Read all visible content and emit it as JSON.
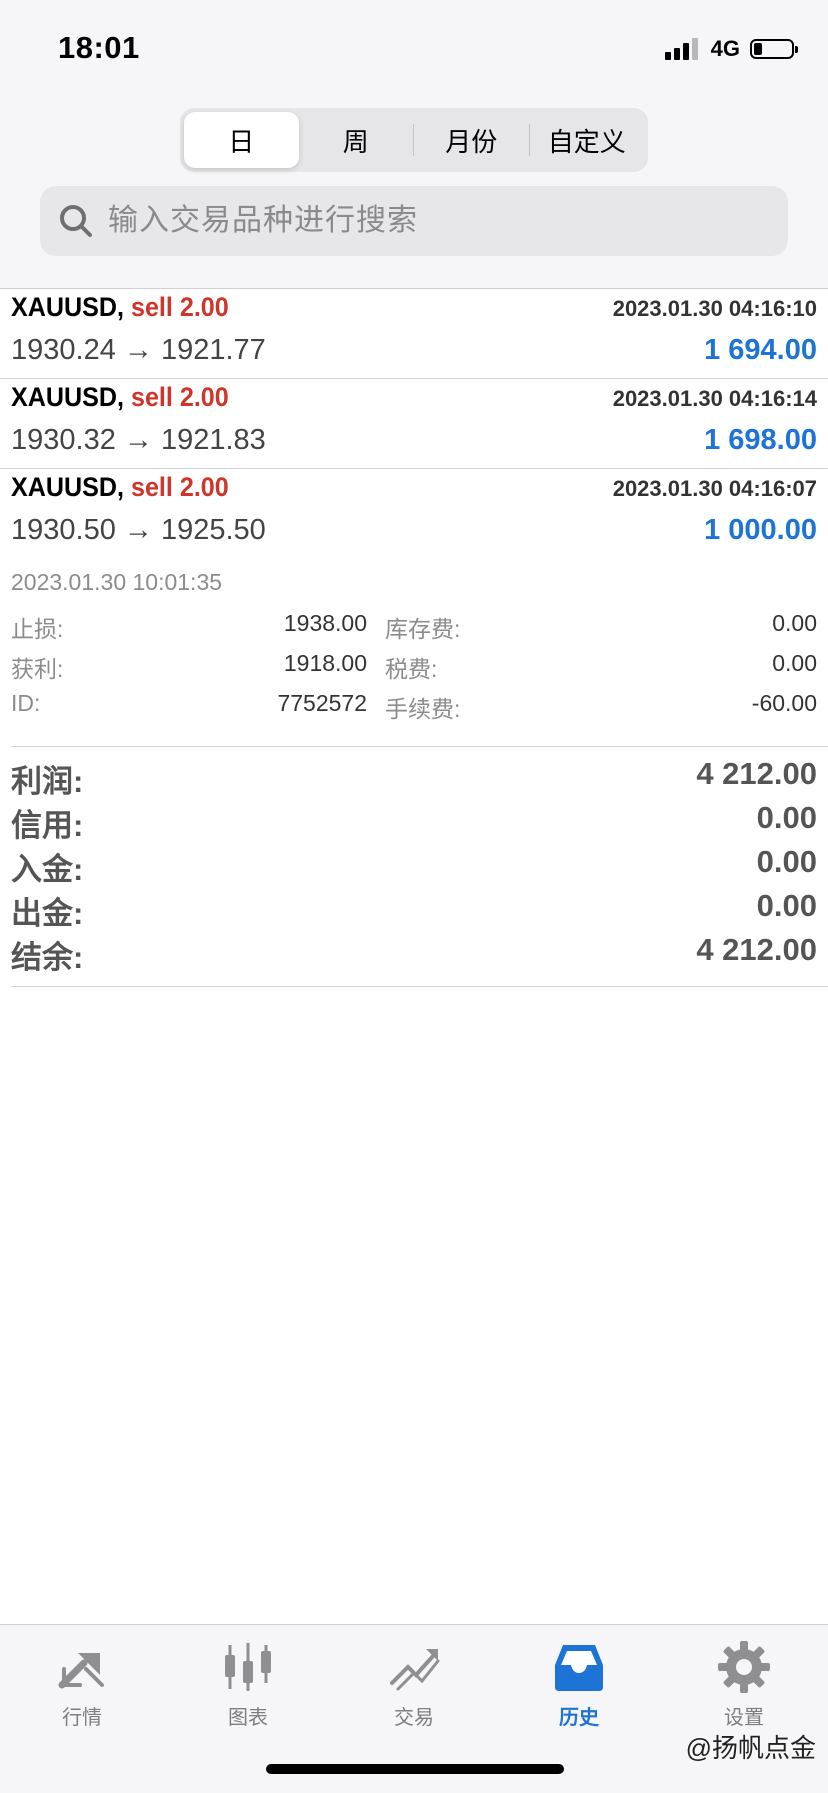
{
  "status_bar": {
    "time": "18:01",
    "network": "4G"
  },
  "period_tabs": [
    {
      "label": "日",
      "active": true
    },
    {
      "label": "周",
      "active": false
    },
    {
      "label": "月份",
      "active": false
    },
    {
      "label": "自定义",
      "active": false
    }
  ],
  "search": {
    "placeholder": "输入交易品种进行搜索",
    "value": ""
  },
  "trades": [
    {
      "symbol": "XAUUSD,",
      "side": "sell 2.00",
      "time": "2023.01.30 04:16:10",
      "prices": "1930.24 → 1921.77",
      "profit": "1 694.00"
    },
    {
      "symbol": "XAUUSD,",
      "side": "sell 2.00",
      "time": "2023.01.30 04:16:14",
      "prices": "1930.32 → 1921.83",
      "profit": "1 698.00"
    },
    {
      "symbol": "XAUUSD,",
      "side": "sell 2.00",
      "time": "2023.01.30 04:16:07",
      "prices": "1930.50 → 1925.50",
      "profit": "1 000.00"
    }
  ],
  "trade_detail": {
    "close_time": "2023.01.30 10:01:35",
    "rows": [
      {
        "label1": "止损:",
        "value1": "1938.00",
        "label2": "库存费:",
        "value2": "0.00"
      },
      {
        "label1": "获利:",
        "value1": "1918.00",
        "label2": "税费:",
        "value2": "0.00"
      },
      {
        "label1": "ID:",
        "value1": "7752572",
        "label2": "手续费:",
        "value2": "-60.00"
      }
    ]
  },
  "summary": [
    {
      "label": "利润:",
      "value": "4 212.00"
    },
    {
      "label": "信用:",
      "value": "0.00"
    },
    {
      "label": "入金:",
      "value": "0.00"
    },
    {
      "label": "出金:",
      "value": "0.00"
    },
    {
      "label": "结余:",
      "value": "4 212.00"
    }
  ],
  "tab_bar": [
    {
      "label": "行情",
      "icon": "quotes-icon",
      "active": false
    },
    {
      "label": "图表",
      "icon": "chart-icon",
      "active": false
    },
    {
      "label": "交易",
      "icon": "trade-icon",
      "active": false
    },
    {
      "label": "历史",
      "icon": "history-icon",
      "active": true
    },
    {
      "label": "设置",
      "icon": "settings-icon",
      "active": false
    }
  ],
  "watermark": "@扬帆点金",
  "colors": {
    "accent": "#1d73d6",
    "sell": "#d0352b",
    "inactive_tab": "#7d7d82"
  }
}
